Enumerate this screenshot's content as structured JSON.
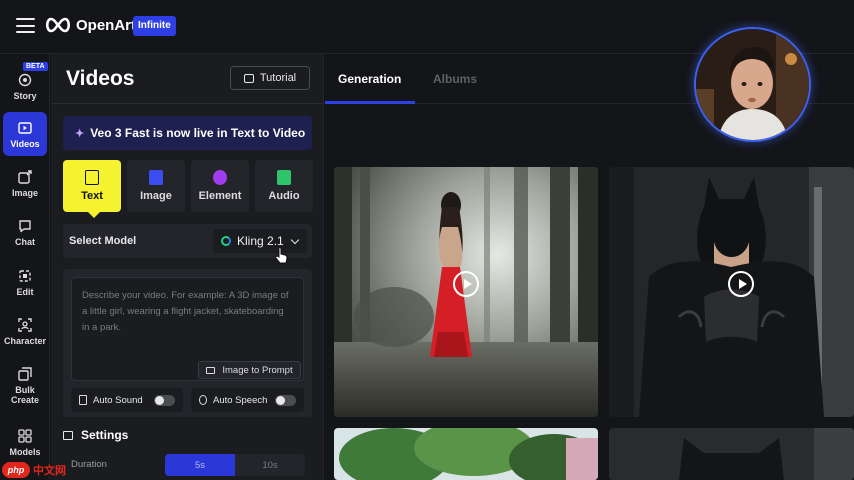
{
  "app": {
    "brand": "OpenArt",
    "plan_badge": "Infinite"
  },
  "sidebar": {
    "beta_badge": "BETA",
    "items": [
      {
        "label": "Story",
        "icon": "story-icon"
      },
      {
        "label": "Videos",
        "icon": "video-icon",
        "active": true
      },
      {
        "label": "Image",
        "icon": "image-edit-icon"
      },
      {
        "label": "Chat",
        "icon": "chat-icon"
      },
      {
        "label": "Edit",
        "icon": "edit-icon"
      },
      {
        "label": "Character",
        "icon": "character-icon"
      },
      {
        "label": "Bulk Create",
        "icon": "bulk-create-icon"
      },
      {
        "label": "Models",
        "icon": "models-icon"
      }
    ]
  },
  "panel": {
    "title": "Videos",
    "tutorial_label": "Tutorial",
    "announcement": "Veo 3 Fast is now live in Text to Video",
    "mode_tabs": [
      {
        "label": "Text",
        "active": true,
        "color": "#f5f230"
      },
      {
        "label": "Image",
        "color": "#3b4cf0"
      },
      {
        "label": "Element",
        "color": "#a23cf0"
      },
      {
        "label": "Audio",
        "color": "#2fc46a"
      }
    ],
    "select_model_label": "Select Model",
    "model_value": "Kling 2.1",
    "prompt_placeholder": "Describe your video. For example: A 3D image of a little girl, wearing a flight jacket, skateboarding in a park.",
    "image_to_prompt_label": "Image to Prompt",
    "auto_sound_label": "Auto Sound",
    "auto_speech_label": "Auto Speech",
    "settings_label": "Settings",
    "duration_label": "Duration",
    "duration_options": [
      "5s",
      "10s"
    ],
    "duration_selected": "5s"
  },
  "main": {
    "tabs": [
      {
        "label": "Generation",
        "active": true
      },
      {
        "label": "Albums",
        "active": false
      }
    ]
  },
  "watermark": {
    "logo": "php",
    "text": "中文网"
  },
  "colors": {
    "accent_blue": "#2c37d8",
    "text_tab_yellow": "#f5f230",
    "background": "#141518"
  }
}
